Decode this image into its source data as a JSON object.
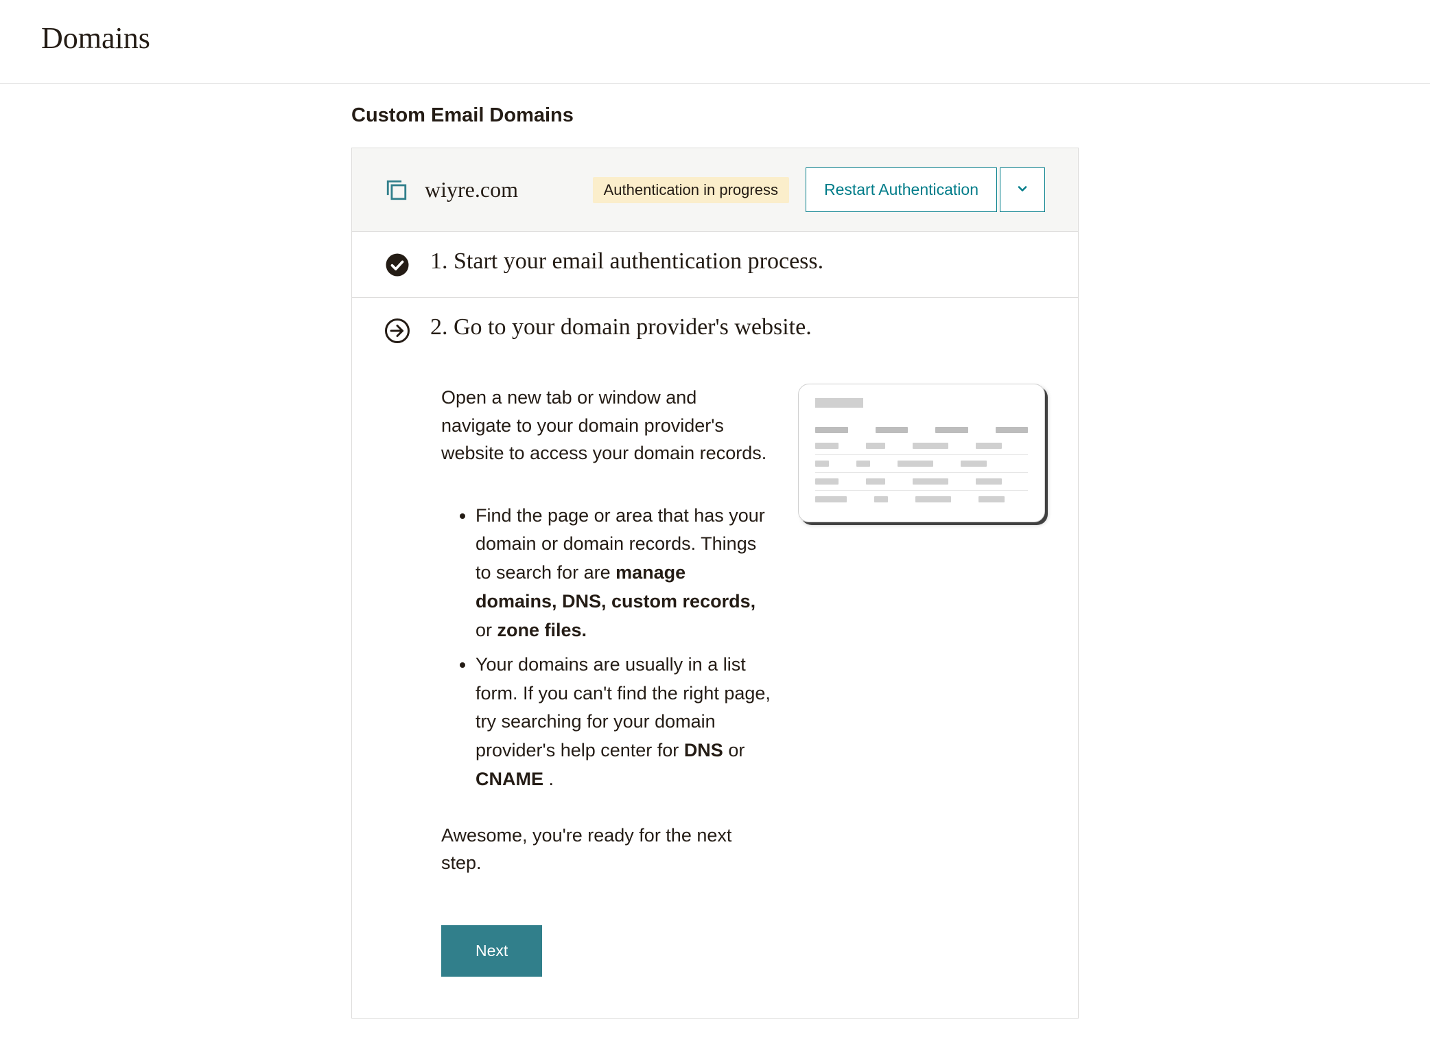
{
  "header": {
    "title": "Domains"
  },
  "section": {
    "title": "Custom Email Domains"
  },
  "domain_panel": {
    "domain": "wiyre.com",
    "status": "Authentication in progress",
    "restart_label": "Restart Authentication"
  },
  "steps": {
    "step1": {
      "title": "1. Start your email authentication process."
    },
    "step2": {
      "title": "2. Go to your domain provider's website.",
      "intro": "Open a new tab or window and navigate to your domain provider's website to access your domain records.",
      "bullet1_a": "Find the page or area that has your domain or domain records. Things to search for are ",
      "bullet1_b1": "manage domains, DNS, custom records,",
      "bullet1_c": " or ",
      "bullet1_b2": "zone files.",
      "bullet2_a": "Your domains are usually in a list form. If you can't find the right page, try searching for your domain provider's help center for ",
      "bullet2_b1": "DNS",
      "bullet2_c": " or ",
      "bullet2_b2": "CNAME",
      "bullet2_d": " .",
      "outro": "Awesome, you're ready for the next step.",
      "next_label": "Next"
    }
  }
}
